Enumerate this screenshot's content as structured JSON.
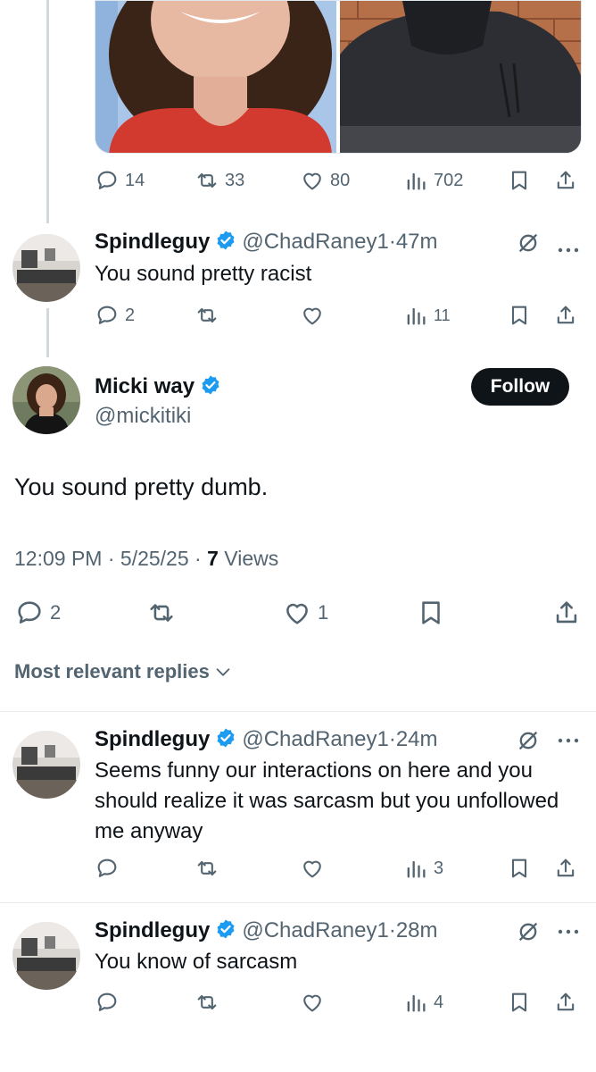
{
  "colors": {
    "accent": "#1d9bf0",
    "text": "#0f1419",
    "muted": "#536471",
    "verified": "#1d9bf0"
  },
  "top_tweet": {
    "stats": {
      "replies": "14",
      "reposts": "33",
      "likes": "80",
      "views": "702"
    }
  },
  "reply1": {
    "name": "Spindleguy",
    "handle": "@ChadRaney1",
    "sep": "·",
    "time": "47m",
    "text": "You sound pretty racist",
    "stats": {
      "replies": "2",
      "reposts": "",
      "likes": "",
      "views": "11"
    }
  },
  "main": {
    "name": "Micki way",
    "handle": "@mickitiki",
    "follow_label": "Follow",
    "text": "You sound pretty dumb.",
    "time": "12:09 PM",
    "sep1": "·",
    "date": "5/25/25",
    "sep2": "·",
    "views_count": "7",
    "views_label": "Views",
    "stats": {
      "replies": "2",
      "likes": "1"
    }
  },
  "sort_label": "Most relevant replies",
  "replies": [
    {
      "name": "Spindleguy",
      "handle": "@ChadRaney1",
      "sep": "·",
      "time": "24m",
      "text": "Seems funny our interactions on here and you should realize it was sarcasm but you unfollowed me anyway",
      "views": "3"
    },
    {
      "name": "Spindleguy",
      "handle": "@ChadRaney1",
      "sep": "·",
      "time": "28m",
      "text": "You know of sarcasm",
      "views": "4"
    }
  ]
}
